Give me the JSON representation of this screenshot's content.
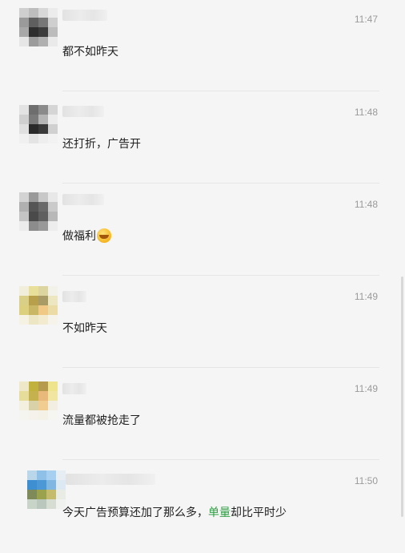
{
  "messages": [
    {
      "time": "11:47",
      "text": "都不如昨天"
    },
    {
      "time": "11:48",
      "text": "还打折，广告开"
    },
    {
      "time": "11:48",
      "text": "做福利",
      "emoji": "grinning-sweat-emoji"
    },
    {
      "time": "11:49",
      "text": "不如昨天"
    },
    {
      "time": "11:49",
      "text": "流量都被抢走了"
    },
    {
      "time": "11:50",
      "text_before": "今天广告预算还加了那么多，",
      "text_highlight": "单量",
      "text_after": "却比平时少"
    }
  ],
  "colors": {
    "background": "#f5f5f5",
    "text": "#1f1f1f",
    "time": "#9a9a9a",
    "highlight": "#2f9e44"
  }
}
